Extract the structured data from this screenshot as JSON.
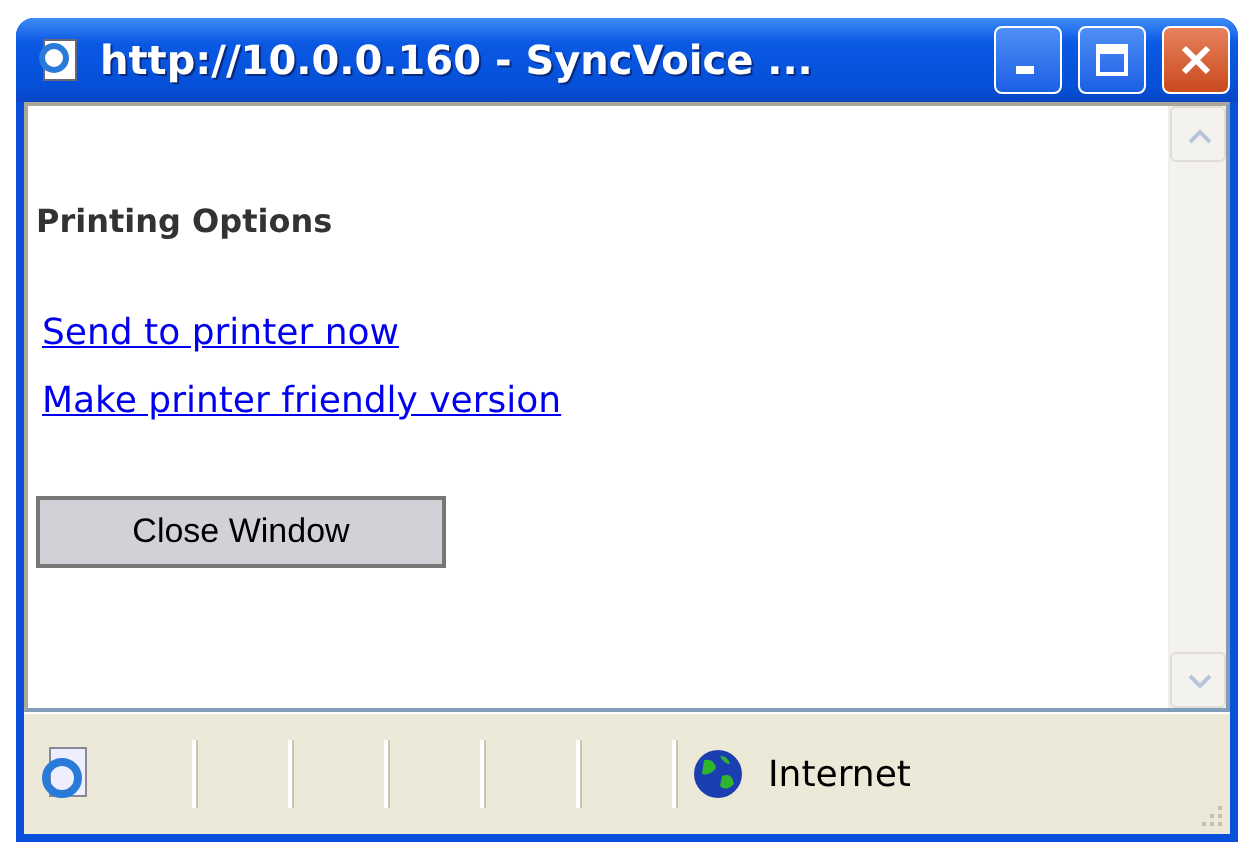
{
  "window": {
    "title": "http://10.0.0.160 - SyncVoice ..."
  },
  "page": {
    "heading": "Printing Options",
    "links": [
      "Send to printer now",
      "Make printer friendly version"
    ],
    "button": "Close Window"
  },
  "status_bar": {
    "zone": "Internet"
  }
}
